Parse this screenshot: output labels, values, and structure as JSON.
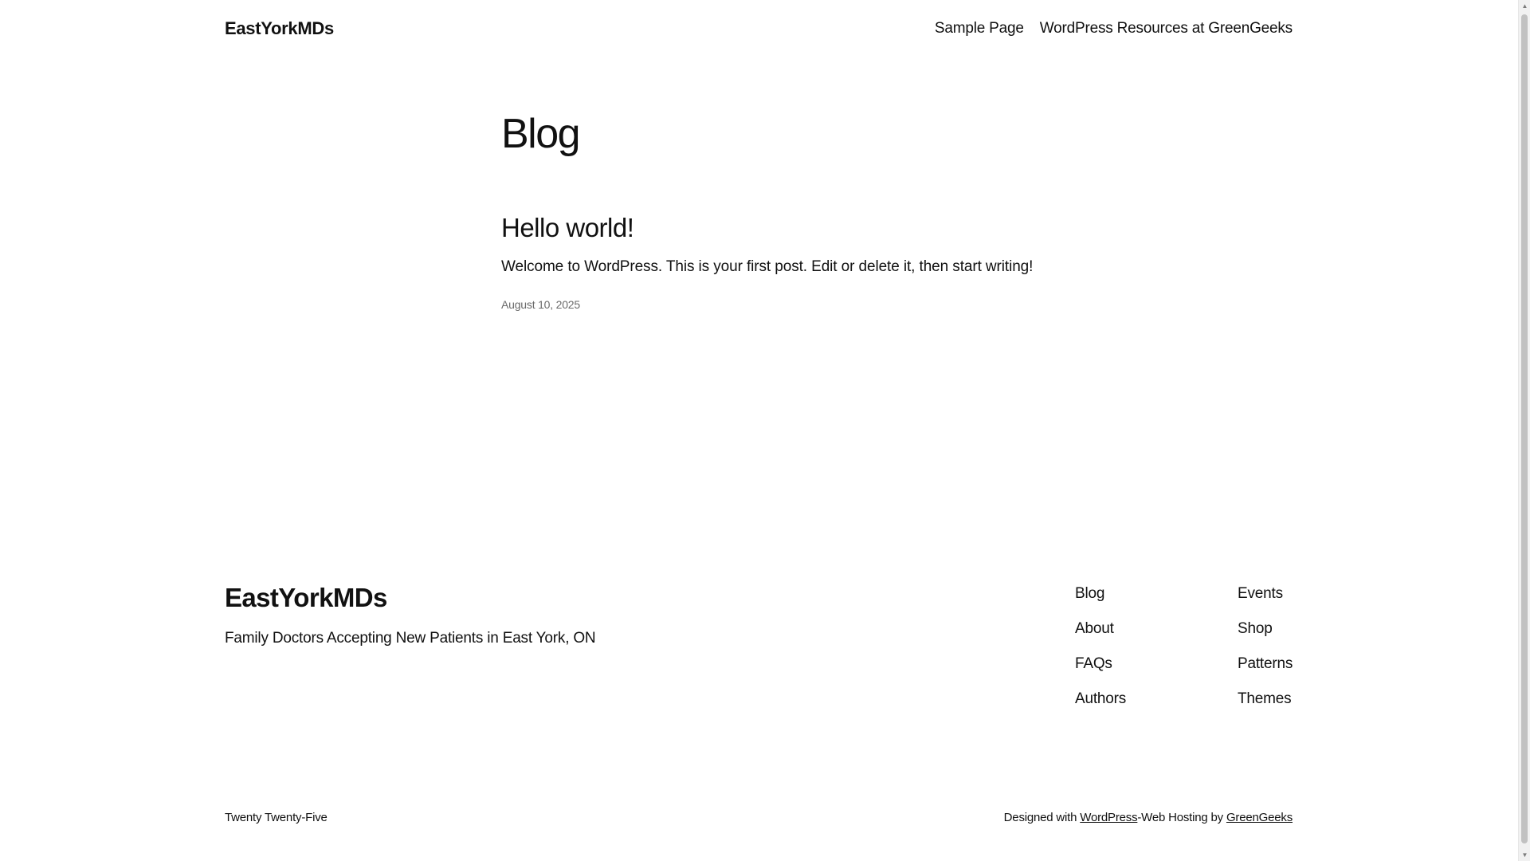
{
  "header": {
    "site_title": "EastYorkMDs",
    "nav": [
      {
        "label": "Sample Page"
      },
      {
        "label": "WordPress Resources at GreenGeeks"
      }
    ]
  },
  "main": {
    "heading": "Blog",
    "posts": [
      {
        "title": "Hello world!",
        "excerpt": "Welcome to WordPress. This is your first post. Edit or delete it, then start writing!",
        "date": "August 10, 2025"
      }
    ]
  },
  "footer": {
    "site_title": "EastYorkMDs",
    "tagline": "Family Doctors Accepting New Patients in East York, ON",
    "nav_col_1": [
      {
        "label": "Blog"
      },
      {
        "label": "About"
      },
      {
        "label": "FAQs"
      },
      {
        "label": "Authors"
      }
    ],
    "nav_col_2": [
      {
        "label": "Events"
      },
      {
        "label": "Shop"
      },
      {
        "label": "Patterns"
      },
      {
        "label": "Themes"
      }
    ],
    "theme_name": "Twenty Twenty-Five",
    "credits": {
      "designed_with": "Designed with ",
      "wordpress_link": "WordPress",
      "hosting_text": "-Web Hosting by ",
      "greengeeks_link": "GreenGeeks"
    }
  },
  "scrollbar": {
    "up_icon": "▲",
    "down_icon": "▼"
  }
}
